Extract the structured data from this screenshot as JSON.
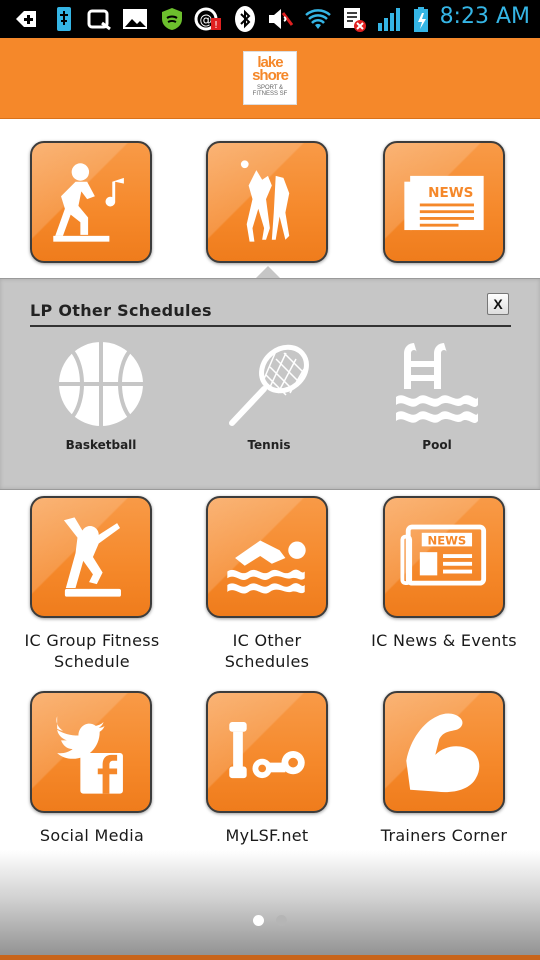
{
  "status_bar": {
    "time": "8:23 AM",
    "icons": [
      "add-icon",
      "usb-debug-icon",
      "q-icon",
      "image-icon",
      "shield-icon",
      "mail-alert-icon",
      "bluetooth-icon",
      "mute-icon",
      "wifi-icon",
      "sim-blocked-icon",
      "signal-icon",
      "battery-charging-icon"
    ],
    "accent": "#35b5e5"
  },
  "header": {
    "logo_line1": "lake",
    "logo_line2": "shore",
    "logo_line3": "SPORT & FITNESS SF",
    "color": "#f5882a"
  },
  "top_tiles": [
    {
      "icon": "dance-step-icon",
      "label": ""
    },
    {
      "icon": "basketball-players-icon",
      "label": ""
    },
    {
      "icon": "newspaper-icon",
      "label": ""
    }
  ],
  "popup": {
    "title": "LP Other Schedules",
    "close_label": "X",
    "items": [
      {
        "icon": "basketball-icon",
        "label": "Basketball"
      },
      {
        "icon": "tennis-racket-icon",
        "label": "Tennis"
      },
      {
        "icon": "pool-icon",
        "label": "Pool"
      }
    ]
  },
  "tiles": [
    {
      "icon": "group-fitness-icon",
      "label_line1": "IC Group Fitness",
      "label_line2": "Schedule"
    },
    {
      "icon": "swimmer-icon",
      "label_line1": "IC Other",
      "label_line2": "Schedules"
    },
    {
      "icon": "news-events-icon",
      "label_line1": "IC News & Events",
      "label_line2": ""
    },
    {
      "icon": "social-media-icon",
      "label_line1": "Social Media",
      "label_line2": ""
    },
    {
      "icon": "dumbbell-icon",
      "label_line1": "MyLSF.net",
      "label_line2": ""
    },
    {
      "icon": "flexed-arm-icon",
      "label_line1": "Trainers Corner",
      "label_line2": ""
    }
  ],
  "pager": {
    "pages": 2,
    "current": 1
  }
}
